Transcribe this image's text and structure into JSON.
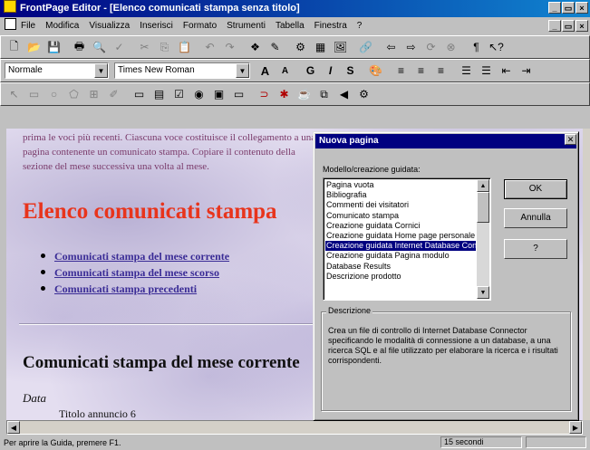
{
  "window": {
    "title": "FrontPage Editor - [Elenco comunicati stampa senza titolo]",
    "min": "_",
    "max": "̲□",
    "close": "×"
  },
  "menu": [
    "File",
    "Modifica",
    "Visualizza",
    "Inserisci",
    "Formato",
    "Strumenti",
    "Tabella",
    "Finestra",
    "?"
  ],
  "format_bar": {
    "style": "Normale",
    "font": "Times New Roman",
    "bold": "G",
    "italic": "I",
    "underline": "S"
  },
  "page": {
    "intro": "prima le voci più recenti. Ciascuna voce costituisce il collegamento a una pagina contenente un comunicato stampa. Copiare il contenuto della sezione del mese successiva una volta al mese.",
    "heading": "Elenco comunicati stampa",
    "links": [
      "Comunicati stampa del mese corrente",
      "Comunicati stampa del mese scorso",
      "Comunicati stampa precedenti"
    ],
    "section": "Comunicati stampa del mese corrente",
    "data_label": "Data",
    "titolo": "Titolo annuncio 6"
  },
  "dialog": {
    "title": "Nuova pagina",
    "list_label": "Modello/creazione guidata:",
    "items": [
      "Pagina vuota",
      "Bibliografia",
      "Commenti dei visitatori",
      "Comunicato stampa",
      "Creazione guidata Cornici",
      "Creazione guidata Home page personale",
      "Creazione guidata Internet Database Connector",
      "Creazione guidata Pagina modulo",
      "Database Results",
      "Descrizione prodotto"
    ],
    "selected_index": 6,
    "ok": "OK",
    "cancel": "Annulla",
    "help": "?",
    "desc_label": "Descrizione",
    "desc_text": "Crea un file di controllo di Internet Database Connector specificando le modalità di connessione a un database, a una ricerca SQL e al file utilizzato per elaborare la ricerca e i risultati corrispondenti."
  },
  "status": {
    "text": "Per aprire la Guida, premere F1.",
    "timer": "15 secondi"
  }
}
